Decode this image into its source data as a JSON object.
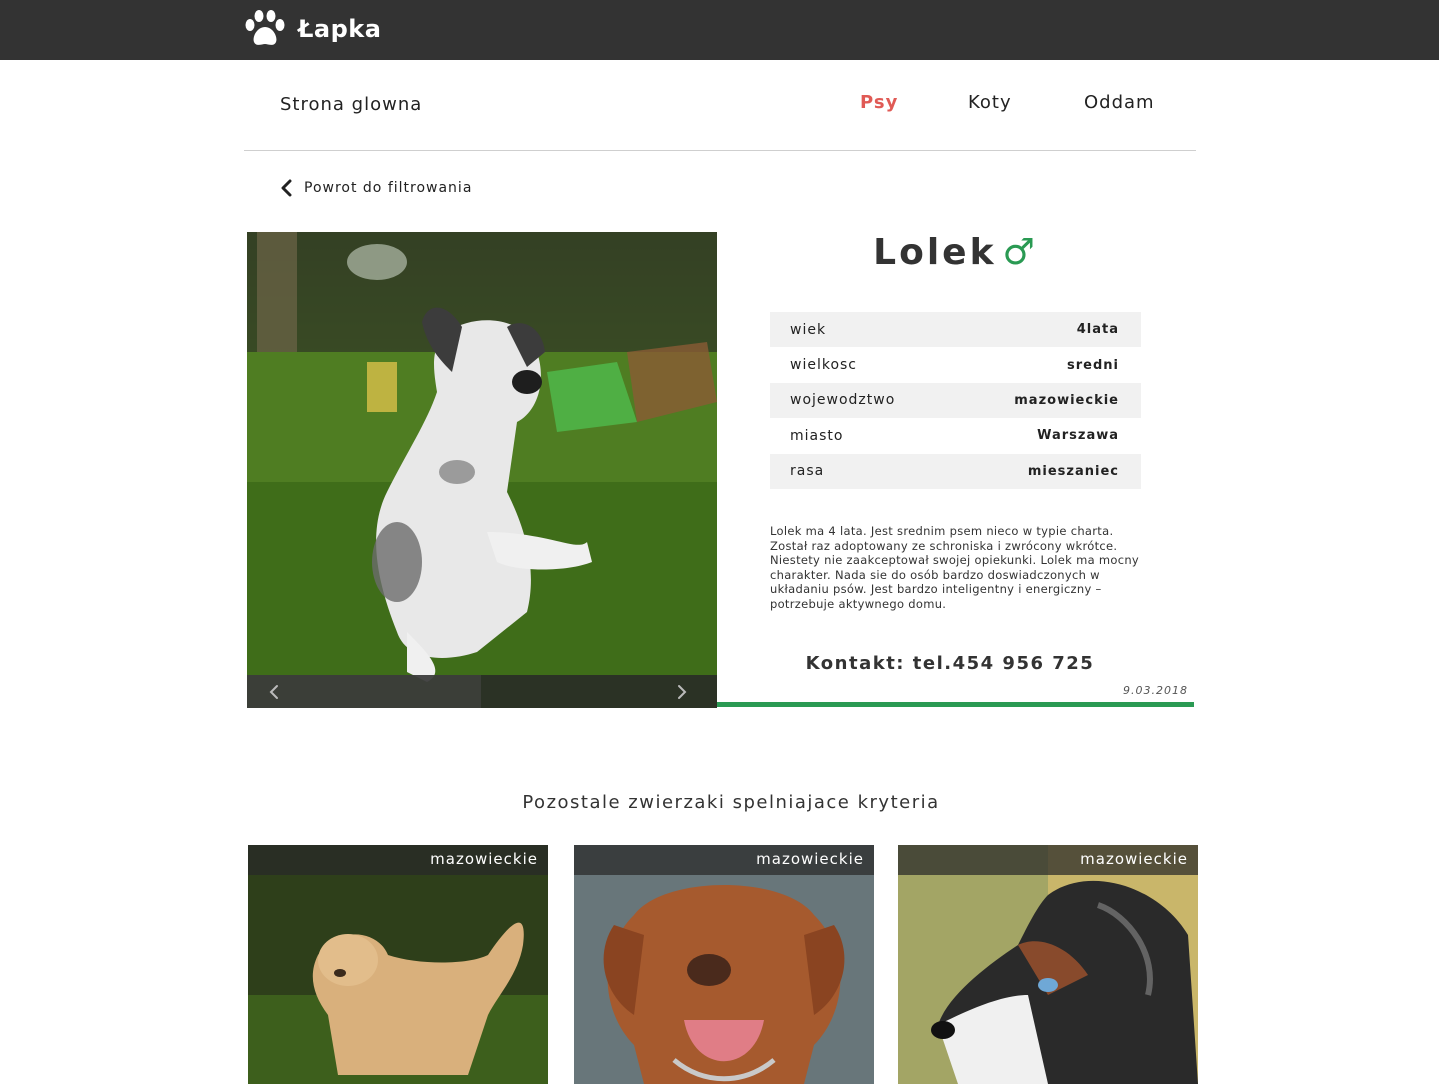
{
  "header": {
    "logo_text": "Łapka",
    "logo_icon": "paw-icon"
  },
  "nav": {
    "home": "Strona glowna",
    "links": [
      "Psy",
      "Koty",
      "Oddam"
    ],
    "active": "Psy"
  },
  "back_link": {
    "label": "Powrot do filtrowania",
    "icon": "chevron-left-icon"
  },
  "pet": {
    "name": "Lolek",
    "sex_symbol": "♂",
    "details": [
      {
        "label": "wiek",
        "value": "4lata"
      },
      {
        "label": "wielkosc",
        "value": "sredni"
      },
      {
        "label": "wojewodztwo",
        "value": "mazowieckie"
      },
      {
        "label": "miasto",
        "value": "Warszawa"
      },
      {
        "label": "rasa",
        "value": "mieszaniec"
      }
    ],
    "description": "Lolek ma 4 lata. Jest srednim psem nieco w typie charta. Został raz adoptowany ze schroniska i zwrócony wkrótce. Niestety nie zaakceptował swojej opiekunki. Lolek ma mocny charakter. Nada  sie do osób bardzo doswiadczonych w układaniu psów. Jest bardzo inteligentny i energiczny – potrzebuje aktywnego domu.",
    "contact": "Kontakt: tel.454 956 725",
    "date": "9.03.2018"
  },
  "gallery": {
    "prev_icon": "chevron-left-icon",
    "next_icon": "chevron-right-icon"
  },
  "others": {
    "title": "Pozostale zwierzaki spelniajace kryteria",
    "cards": [
      {
        "region": "mazowieckie"
      },
      {
        "region": "mazowieckie"
      },
      {
        "region": "mazowieckie"
      }
    ]
  },
  "colors": {
    "topbar": "#333333",
    "accent_active": "#e05a55",
    "accent_green": "#2a9a53"
  }
}
